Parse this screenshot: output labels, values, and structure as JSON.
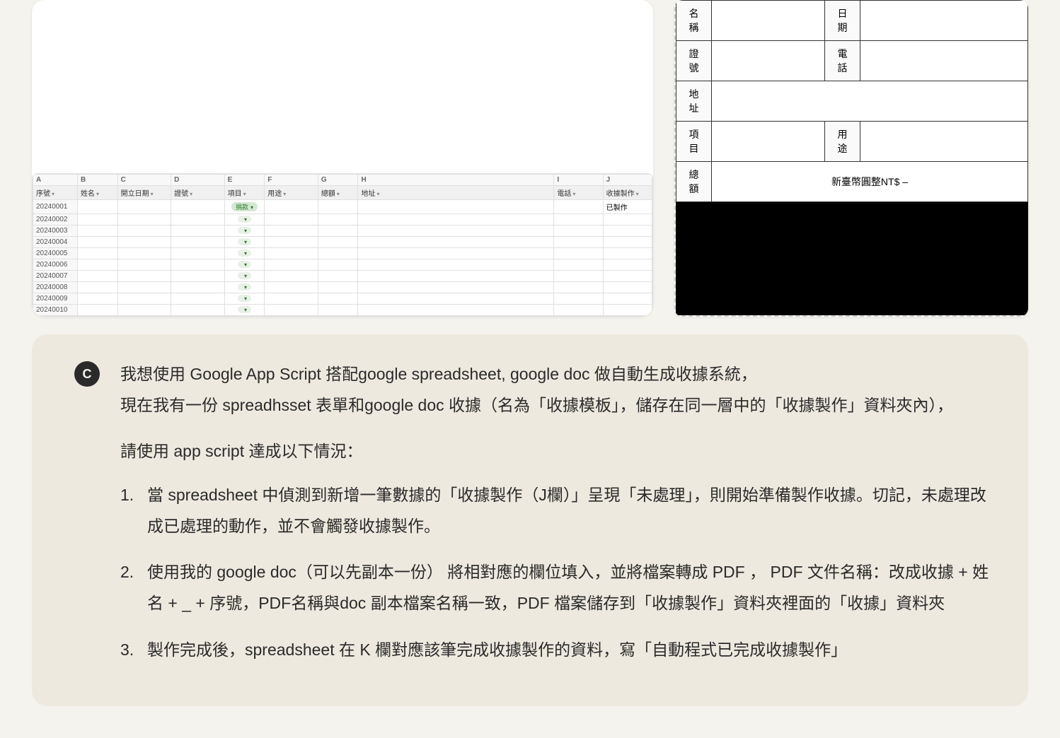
{
  "spreadsheet": {
    "columns": [
      "A",
      "B",
      "C",
      "D",
      "E",
      "F",
      "G",
      "H",
      "I",
      "J"
    ],
    "headers": [
      "序號",
      "姓名",
      "開立日期",
      "證號",
      "項目",
      "用途",
      "總額",
      "地址",
      "電話",
      "收據製作"
    ],
    "rows": [
      {
        "id": "20240001",
        "item_label": "捐款",
        "done": "已製作"
      },
      {
        "id": "20240002",
        "item_label": "",
        "done": ""
      },
      {
        "id": "20240003",
        "item_label": "",
        "done": ""
      },
      {
        "id": "20240004",
        "item_label": "",
        "done": ""
      },
      {
        "id": "20240005",
        "item_label": "",
        "done": ""
      },
      {
        "id": "20240006",
        "item_label": "",
        "done": ""
      },
      {
        "id": "20240007",
        "item_label": "",
        "done": ""
      },
      {
        "id": "20240008",
        "item_label": "",
        "done": ""
      },
      {
        "id": "20240009",
        "item_label": "",
        "done": ""
      },
      {
        "id": "20240010",
        "item_label": "",
        "done": ""
      }
    ]
  },
  "receipt": {
    "labels": {
      "name": "名稱",
      "date": "日期",
      "id_no": "證號",
      "phone": "電話",
      "address": "地址",
      "item": "項目",
      "purpose": "用途",
      "total": "總額"
    },
    "total_text": "新臺幣圓整NT$ –"
  },
  "question": {
    "avatar": "C",
    "p1": "我想使用 Google App Script  搭配google spreadsheet, google doc 做自動生成收據系統，",
    "p2": "現在我有一份 spreadhsset 表單和google doc 收據（名為「收據模板」，儲存在同一層中的「收據製作」資料夾內），",
    "p3": "請使用 app script 達成以下情況：",
    "li1": "當 spreadsheet 中偵測到新增一筆數據的「收據製作（J欄）」呈現「未處理」，則開始準備製作收據。切記，未處理改成已處理的動作，並不會觸發收據製作。",
    "li2": "使用我的 google doc（可以先副本一份） 將相對應的欄位填入，並將檔案轉成 PDF ， PDF 文件名稱：改成收據 + 姓名 + _ + 序號，PDF名稱與doc 副本檔案名稱一致，PDF 檔案儲存到「收據製作」資料夾裡面的「收據」資料夾",
    "li3": "製作完成後，spreadsheet 在 K 欄對應該筆完成收據製作的資料，寫「自動程式已完成收據製作」"
  }
}
